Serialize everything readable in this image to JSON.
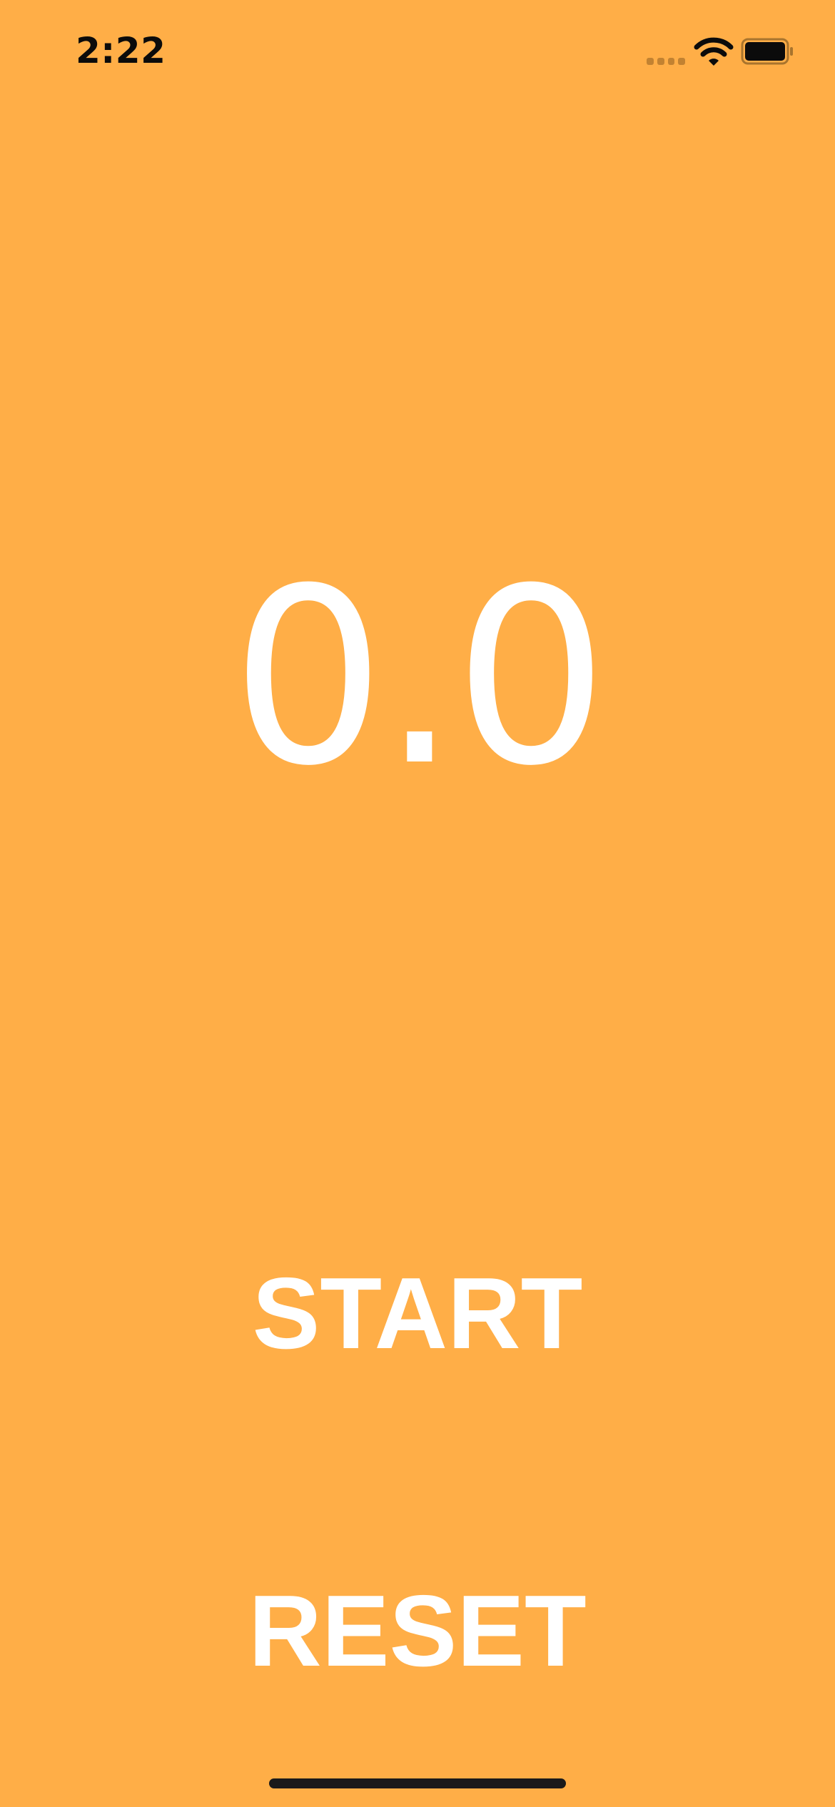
{
  "status_bar": {
    "time": "2:22",
    "signal_icon": "cellular-signal-icon",
    "wifi_icon": "wifi-icon",
    "battery_icon": "battery-icon",
    "battery_level": 1.0
  },
  "timer": {
    "value": "0.0"
  },
  "controls": {
    "start_label": "START",
    "reset_label": "RESET"
  },
  "colors": {
    "background": "#FFAE47",
    "text": "#FFFFFF"
  }
}
